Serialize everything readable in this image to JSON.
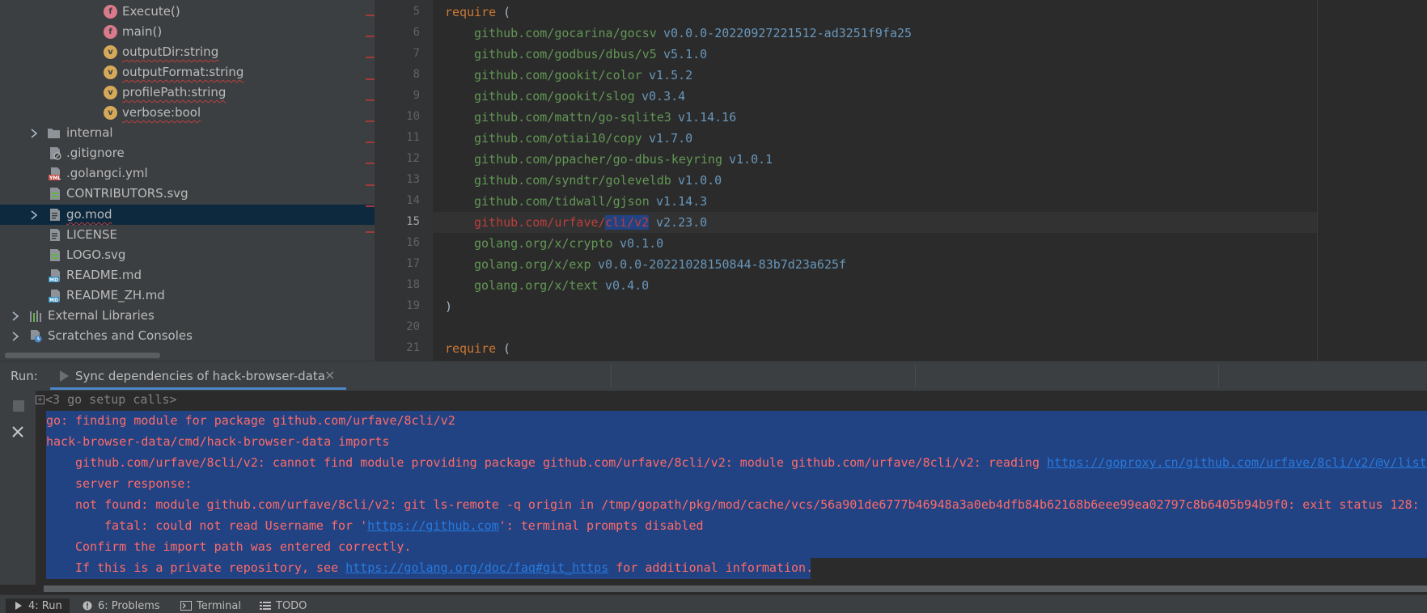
{
  "project": {
    "items": [
      {
        "label": "Execute()",
        "icon": "function-icon",
        "badge": "f"
      },
      {
        "label": "main()",
        "icon": "function-icon",
        "badge": "f"
      },
      {
        "label": "outputDir:string",
        "icon": "variable-icon",
        "badge": "v"
      },
      {
        "label": "outputFormat:string",
        "icon": "variable-icon",
        "badge": "v"
      },
      {
        "label": "profilePath:string",
        "icon": "variable-icon",
        "badge": "v"
      },
      {
        "label": "verbose:bool",
        "icon": "variable-icon",
        "badge": "v"
      },
      {
        "label": "internal",
        "icon": "folder-icon"
      },
      {
        "label": ".gitignore",
        "icon": "gitignore-file-icon"
      },
      {
        "label": ".golangci.yml",
        "icon": "yaml-file-icon",
        "badge": "YML"
      },
      {
        "label": "CONTRIBUTORS.svg",
        "icon": "svg-file-icon"
      },
      {
        "label": "go.mod",
        "icon": "go-mod-file-icon"
      },
      {
        "label": "LICENSE",
        "icon": "text-file-icon"
      },
      {
        "label": "LOGO.svg",
        "icon": "svg-file-icon"
      },
      {
        "label": "README.md",
        "icon": "markdown-file-icon",
        "badge": "MD"
      },
      {
        "label": "README_ZH.md",
        "icon": "markdown-file-icon",
        "badge": "MD"
      },
      {
        "label": "External Libraries",
        "icon": "libraries-icon"
      },
      {
        "label": "Scratches and Consoles",
        "icon": "scratches-icon"
      }
    ]
  },
  "editor": {
    "lines": [
      {
        "n": "5",
        "kw": "require",
        "rest": " ("
      },
      {
        "n": "6",
        "path": "github.com/gocarina/gocsv",
        "ver": "v0.0.0-20220927221512-ad3251f9fa25"
      },
      {
        "n": "7",
        "path": "github.com/godbus/dbus/v5",
        "ver": "v5.1.0"
      },
      {
        "n": "8",
        "path": "github.com/gookit/color",
        "ver": "v1.5.2"
      },
      {
        "n": "9",
        "path": "github.com/gookit/slog",
        "ver": "v0.3.4"
      },
      {
        "n": "10",
        "path": "github.com/mattn/go-sqlite3",
        "ver": "v1.14.16"
      },
      {
        "n": "11",
        "path": "github.com/otiai10/copy",
        "ver": "v1.7.0"
      },
      {
        "n": "12",
        "path": "github.com/ppacher/go-dbus-keyring",
        "ver": "v1.0.1"
      },
      {
        "n": "13",
        "path": "github.com/syndtr/goleveldb",
        "ver": "v1.0.0"
      },
      {
        "n": "14",
        "path": "github.com/tidwall/gjson",
        "ver": "v1.14.3"
      },
      {
        "n": "15",
        "path_a": "github.com/urfave/",
        "path_b": "cli/v2",
        "ver": "v2.23.0"
      },
      {
        "n": "16",
        "path": "golang.org/x/crypto",
        "ver": "v0.1.0"
      },
      {
        "n": "17",
        "path": "golang.org/x/exp",
        "ver": "v0.0.0-20221028150844-83b7d23a625f"
      },
      {
        "n": "18",
        "path": "golang.org/x/text",
        "ver": "v0.4.0"
      },
      {
        "n": "19",
        "rest": ")"
      },
      {
        "n": "20"
      },
      {
        "n": "21",
        "kw": "require",
        "rest": " ("
      }
    ]
  },
  "run": {
    "label": "Run:",
    "tab_title": "Sync dependencies of hack-browser-data",
    "tab_close": "×",
    "folded": "<3 go setup calls>",
    "fold_sign": "+",
    "lines": {
      "l1": "go: finding module for package github.com/urfave/8cli/v2",
      "l2": "hack-browser-data/cmd/hack-browser-data imports",
      "l3a": "github.com/urfave/8cli/v2: cannot find module providing package github.com/urfave/8cli/v2: module github.com/urfave/8cli/v2: reading ",
      "l3link": "https://goproxy.cn/github.com/urfave/8cli/v2/@v/list",
      "l3b": ":",
      "l4": "server response:",
      "l5": "not found: module github.com/urfave/8cli/v2: git ls-remote -q origin in /tmp/gopath/pkg/mod/cache/vcs/56a901de6777b46948a3a0eb4dfb84b62168b6eee99ea02797c8b6405b94b9f0: exit status 128:",
      "l6a": "fatal: could not read Username for '",
      "l6link": "https://github.com",
      "l6b": "': terminal prompts disabled",
      "l7": "Confirm the import path was entered correctly.",
      "l8a": "If this is a private repository, see ",
      "l8link": "https://golang.org/doc/faq#git_https",
      "l8b": " for additional information."
    }
  },
  "toolstrip": {
    "run": "4: Run",
    "problems": "6: Problems",
    "terminal": "Terminal",
    "todo": "TODO"
  }
}
